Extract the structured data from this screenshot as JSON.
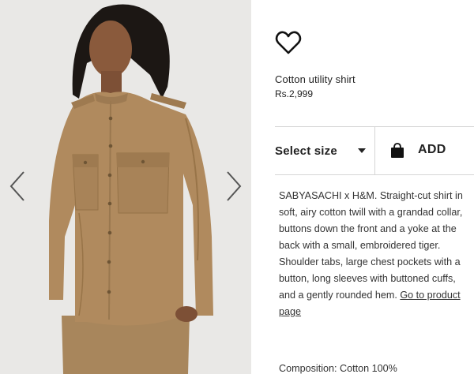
{
  "product": {
    "title": "Cotton utility shirt",
    "price": "Rs.2,999"
  },
  "controls": {
    "size_label": "Select size",
    "add_label": "ADD"
  },
  "description": {
    "text": "SABYASACHI x H&M. Straight-cut shirt in soft, airy cotton twill with a grandad collar, buttons down the front and a yoke at the back with a small, embroidered tiger. Shoulder tabs, large chest pockets with a button, long sleeves with buttoned cuffs, and a gently rounded hem.",
    "link_text": "Go to product page"
  },
  "composition": "Composition: Cotton 100%",
  "icons": {
    "wishlist": "heart-outline-icon",
    "bag": "shopping-bag-icon",
    "prev": "chevron-left-icon",
    "next": "chevron-right-icon"
  },
  "colors": {
    "shirt": "#b08a5e",
    "image_bg": "#e9e8e6",
    "text": "#222222"
  }
}
